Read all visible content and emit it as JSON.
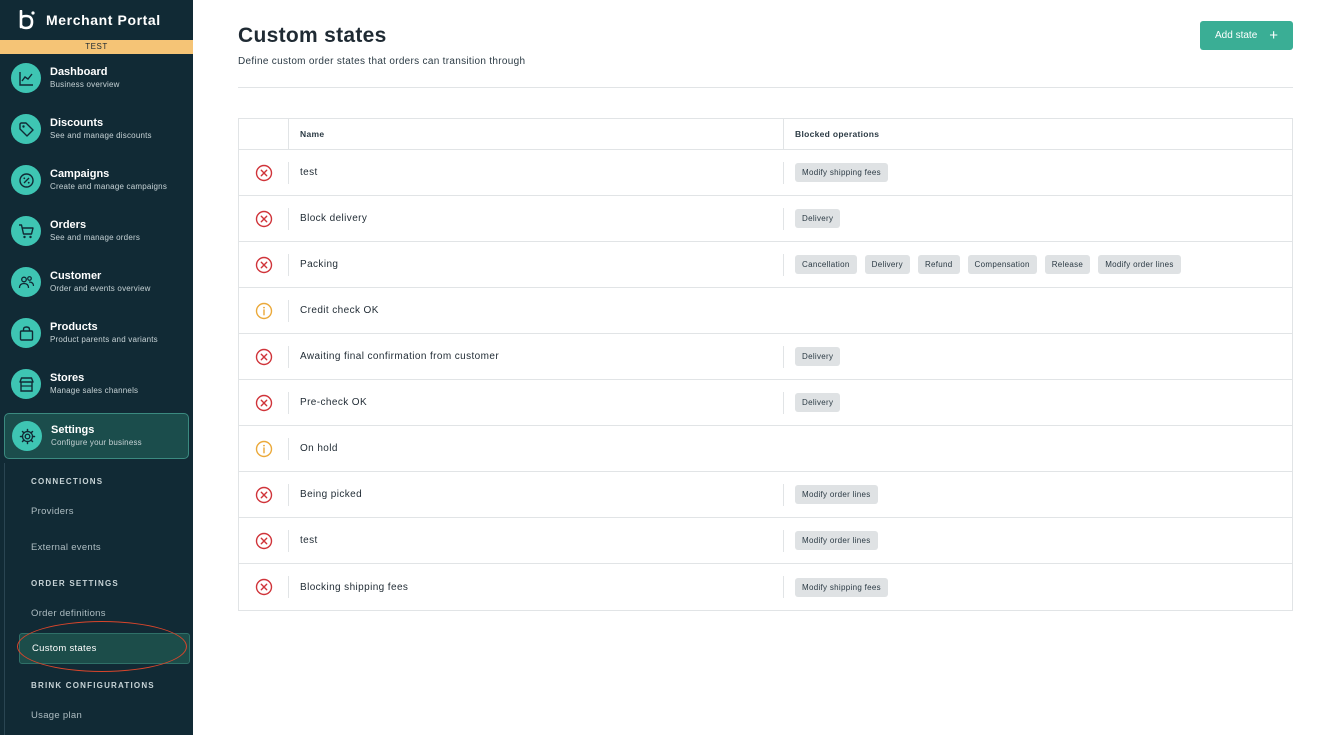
{
  "app": {
    "title": "Merchant Portal",
    "env_badge": "TEST"
  },
  "sidebar": {
    "items": [
      {
        "title": "Dashboard",
        "subtitle": "Business overview",
        "icon": "chart-line-icon"
      },
      {
        "title": "Discounts",
        "subtitle": "See and manage discounts",
        "icon": "tag-icon"
      },
      {
        "title": "Campaigns",
        "subtitle": "Create and manage campaigns",
        "icon": "percent-icon"
      },
      {
        "title": "Orders",
        "subtitle": "See and manage orders",
        "icon": "cart-icon"
      },
      {
        "title": "Customer",
        "subtitle": "Order and events overview",
        "icon": "users-icon"
      },
      {
        "title": "Products",
        "subtitle": "Product parents and variants",
        "icon": "bag-icon"
      },
      {
        "title": "Stores",
        "subtitle": "Manage sales channels",
        "icon": "store-icon"
      },
      {
        "title": "Settings",
        "subtitle": "Configure your business",
        "icon": "gear-icon"
      }
    ],
    "subnav": {
      "connections_header": "CONNECTIONS",
      "providers": "Providers",
      "external_events": "External events",
      "order_settings_header": "ORDER SETTINGS",
      "order_definitions": "Order definitions",
      "custom_states": "Custom states",
      "brink_header": "BRINK CONFIGURATIONS",
      "usage_plan": "Usage plan"
    }
  },
  "main": {
    "title": "Custom states",
    "subtitle": "Define custom order states that orders can transition through",
    "add_button": "Add state",
    "table": {
      "headers": {
        "name": "Name",
        "ops": "Blocked operations"
      },
      "rows": [
        {
          "name": "test",
          "status": "blocked",
          "ops": [
            "Modify shipping fees"
          ]
        },
        {
          "name": "Block delivery",
          "status": "blocked",
          "ops": [
            "Delivery"
          ]
        },
        {
          "name": "Packing",
          "status": "blocked",
          "ops": [
            "Cancellation",
            "Delivery",
            "Refund",
            "Compensation",
            "Release",
            "Modify order lines"
          ]
        },
        {
          "name": "Credit check OK",
          "status": "info",
          "ops": []
        },
        {
          "name": "Awaiting final confirmation from customer",
          "status": "blocked",
          "ops": [
            "Delivery"
          ]
        },
        {
          "name": "Pre-check OK",
          "status": "blocked",
          "ops": [
            "Delivery"
          ]
        },
        {
          "name": "On hold",
          "status": "info",
          "ops": []
        },
        {
          "name": "Being picked",
          "status": "blocked",
          "ops": [
            "Modify order lines"
          ]
        },
        {
          "name": "test",
          "status": "blocked",
          "ops": [
            "Modify order lines"
          ]
        },
        {
          "name": "Blocking shipping fees",
          "status": "blocked",
          "ops": [
            "Modify shipping fees"
          ]
        }
      ]
    }
  },
  "colors": {
    "sidebar_bg": "#112a35",
    "accent": "#3ec5b3",
    "button": "#3aae95",
    "badge": "#f5c476",
    "blocked": "#d0343a",
    "info": "#eba93a"
  }
}
